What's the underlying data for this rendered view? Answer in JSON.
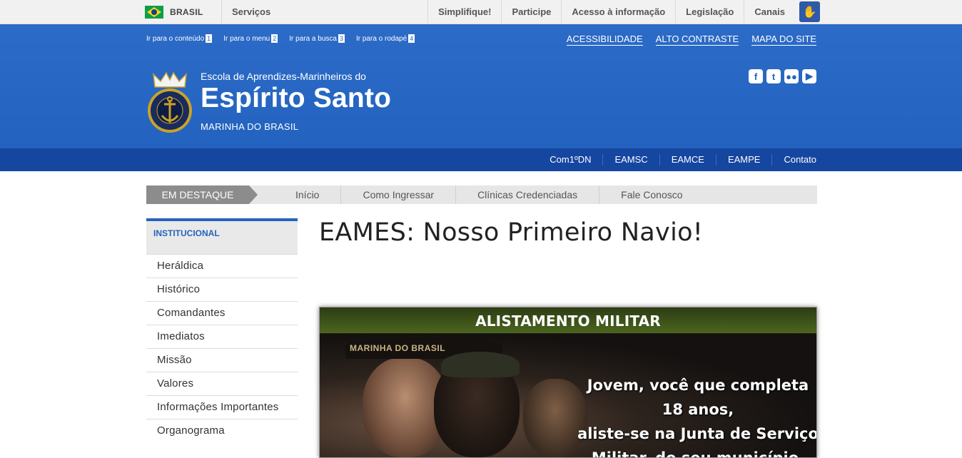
{
  "govbar": {
    "country": "BRASIL",
    "services": "Serviços",
    "links": [
      "Simplifique!",
      "Participe",
      "Acesso à informação",
      "Legislação",
      "Canais"
    ]
  },
  "skip_links": [
    {
      "label": "Ir para o conteúdo",
      "key": "1"
    },
    {
      "label": "Ir para o menu",
      "key": "2"
    },
    {
      "label": "Ir para a busca",
      "key": "3"
    },
    {
      "label": "Ir para o rodapé",
      "key": "4"
    }
  ],
  "accessibility": [
    "ACESSIBILIDADE",
    "ALTO CONTRASTE",
    "MAPA DO SITE"
  ],
  "site": {
    "pre_title": "Escola de Aprendizes-Marinheiros do",
    "title": "Espírito Santo",
    "subtitle": "MARINHA DO BRASIL",
    "logo_text": "MARINHA DO BRASIL"
  },
  "social": [
    "facebook-icon",
    "twitter-icon",
    "flickr-icon",
    "youtube-icon"
  ],
  "service_nav": [
    "Com1ºDN",
    "EAMSC",
    "EAMCE",
    "EAMPE",
    "Contato"
  ],
  "highlights": {
    "label": "EM DESTAQUE",
    "items": [
      "Início",
      "Como Ingressar",
      "Clínicas Credenciadas",
      "Fale Conosco"
    ]
  },
  "sidebar": {
    "heading": "INSTITUCIONAL",
    "items": [
      "Heráldica",
      "Histórico",
      "Comandantes",
      "Imediatos",
      "Missão",
      "Valores",
      "Informações Importantes",
      "Organograma"
    ]
  },
  "content": {
    "title": "EAMES: Nosso Primeiro Navio!",
    "banner_heading": "ALISTAMENTO MILITAR",
    "banner_cap_text": "MARINHA DO BRASIL",
    "banner_lines": [
      "Jovem, você que completa 18 anos,",
      "aliste-se na Junta de Serviço",
      "Militar, do seu município,"
    ]
  },
  "colors": {
    "header_blue": "#2363bf",
    "nav_blue": "#1546a0",
    "banner_green": "#4b661e"
  }
}
